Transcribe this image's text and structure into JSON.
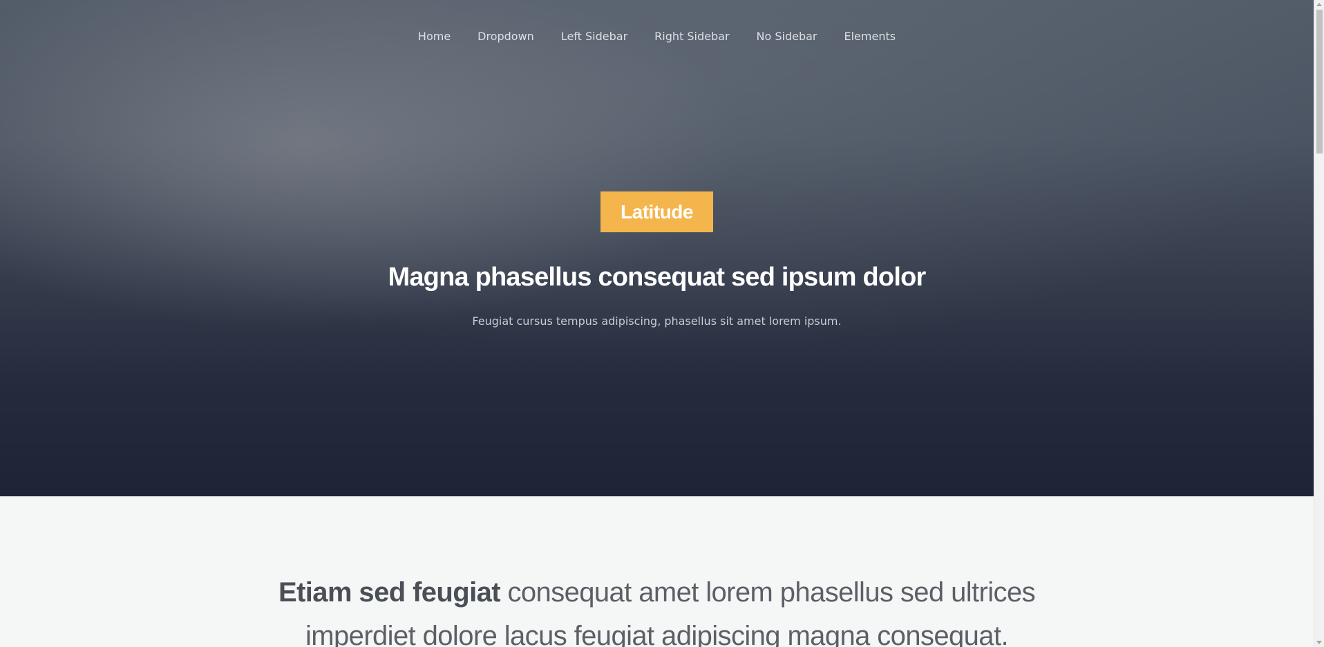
{
  "nav": {
    "items": [
      {
        "label": "Home"
      },
      {
        "label": "Dropdown"
      },
      {
        "label": "Left Sidebar"
      },
      {
        "label": "Right Sidebar"
      },
      {
        "label": "No Sidebar"
      },
      {
        "label": "Elements"
      }
    ]
  },
  "hero": {
    "badge": "Latitude",
    "title": "Magna phasellus consequat sed ipsum dolor",
    "subtitle": "Feugiat cursus tempus adipiscing, phasellus sit amet lorem ipsum."
  },
  "intro": {
    "strong": "Etiam sed feugiat",
    "line1_rest": "consequat amet lorem phasellus sed ultrices",
    "line2": "imperdiet dolore lacus feugiat adipiscing magna consequat."
  },
  "colors": {
    "accent": "#f5b54d",
    "hero_top": "#535c69",
    "hero_bottom": "#1e2436",
    "section_bg": "#f5f7f7"
  },
  "icons": {
    "scroll_up": "chevron-up-icon",
    "scroll_down": "chevron-down-icon"
  }
}
